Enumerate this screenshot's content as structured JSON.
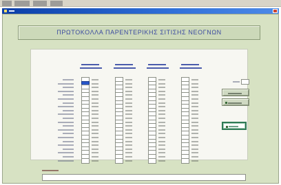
{
  "window": {
    "title": ""
  },
  "header": {
    "title": "ΠΡΩΤΟΚΟΛΛΑ ΠΑΡΕΝΤΕΡΙΚΗΣ ΣΙΤΙΣΗΣ ΝΕΟΓΝΩΝ"
  },
  "menus": [
    {
      "name": "menu-1"
    },
    {
      "name": "menu-2"
    },
    {
      "name": "menu-3"
    },
    {
      "name": "menu-4"
    }
  ],
  "form": {
    "columns": [
      {
        "name": "col-1"
      },
      {
        "name": "col-2"
      },
      {
        "name": "col-3"
      },
      {
        "name": "col-4"
      }
    ],
    "row_count": 22,
    "side_field": {
      "value": ""
    }
  },
  "comments": {
    "value": ""
  },
  "buttons": [
    {
      "name": "action-button-1"
    },
    {
      "name": "action-button-2"
    },
    {
      "name": "action-button-3"
    }
  ],
  "colors": {
    "background": "#d7e2c3",
    "titlebar": "#2f6fd8",
    "header_text": "#3b4aa0",
    "primary_button_border": "#2f7a55",
    "active_cell": "#2a57c8"
  }
}
